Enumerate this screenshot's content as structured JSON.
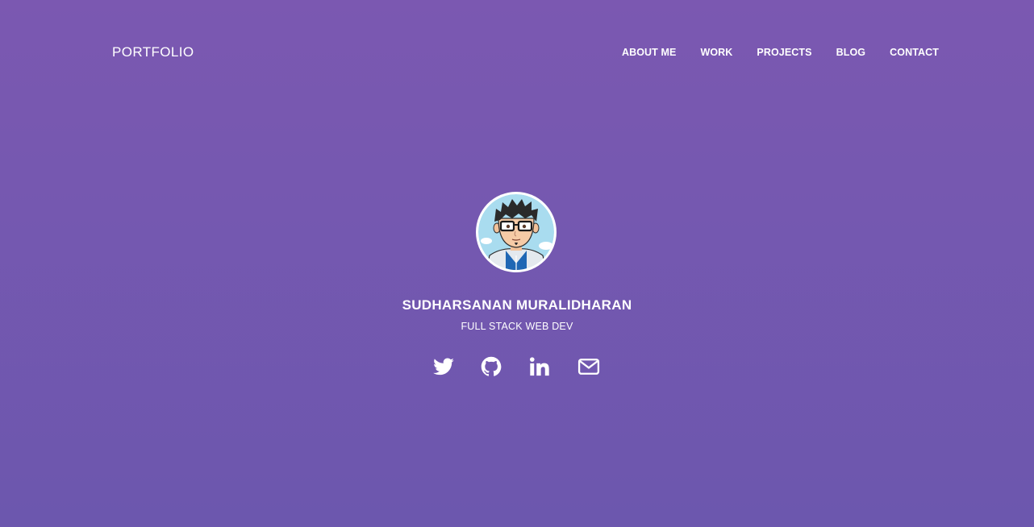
{
  "nav": {
    "brand": "PORTFOLIO",
    "links": [
      {
        "label": "ABOUT ME"
      },
      {
        "label": "WORK"
      },
      {
        "label": "PROJECTS"
      },
      {
        "label": "BLOG"
      },
      {
        "label": "CONTACT"
      }
    ]
  },
  "hero": {
    "name": "SUDHARSANAN MURALIDHARAN",
    "role": "FULL STACK WEB DEV",
    "avatar": "cartoon-avatar-with-glasses",
    "socials": [
      {
        "icon": "twitter-icon"
      },
      {
        "icon": "github-icon"
      },
      {
        "icon": "linkedin-icon"
      },
      {
        "icon": "email-icon"
      }
    ]
  },
  "colors": {
    "background_top": "#7b58b1",
    "background_bottom": "#6c57ae",
    "text": "#ffffff"
  }
}
